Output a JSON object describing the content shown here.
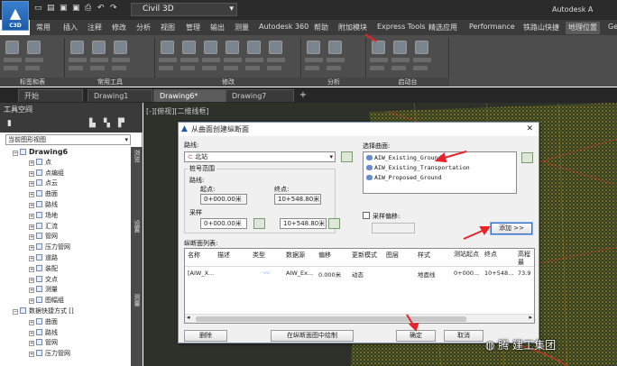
{
  "app": {
    "title": "Autodesk A",
    "app_button_label": "C3D",
    "workspace": "Civil 3D"
  },
  "ribbon": {
    "tabs": [
      "常用",
      "插入",
      "注释",
      "修改",
      "分析",
      "视图",
      "管理",
      "输出",
      "测量",
      "Autodesk 360",
      "帮助",
      "附加模块",
      "Express Tools",
      "精选应用",
      "Performance",
      "铁路山快捷",
      "地理位置",
      "Ge"
    ],
    "active_tab": "地理位置",
    "panels": [
      "标签和表",
      "常用工具",
      "修改",
      "分析",
      "启动台"
    ]
  },
  "doc_tabs": [
    "开始",
    "Drawing1",
    "Drawing6*",
    "Drawing7"
  ],
  "active_doc": "Drawing6*",
  "toolspace": {
    "title": "工具空间",
    "view_combo": "当前图形视图",
    "tree": [
      {
        "label": "Drawing6",
        "level": 0,
        "bold": true
      },
      {
        "label": "点",
        "level": 1
      },
      {
        "label": "点编组",
        "level": 1
      },
      {
        "label": "点云",
        "level": 1
      },
      {
        "label": "曲面",
        "level": 1
      },
      {
        "label": "路线",
        "level": 1
      },
      {
        "label": "场地",
        "level": 1
      },
      {
        "label": "汇流",
        "level": 1
      },
      {
        "label": "管网",
        "level": 1
      },
      {
        "label": "压力管网",
        "level": 1
      },
      {
        "label": "道路",
        "level": 1
      },
      {
        "label": "装配",
        "level": 1
      },
      {
        "label": "交点",
        "level": 1
      },
      {
        "label": "测量",
        "level": 1
      },
      {
        "label": "图幅组",
        "level": 1
      },
      {
        "label": "数据快捷方式 []",
        "level": 0
      },
      {
        "label": "曲面",
        "level": 1
      },
      {
        "label": "路线",
        "level": 1
      },
      {
        "label": "管网",
        "level": 1
      },
      {
        "label": "压力管网",
        "level": 1
      }
    ],
    "vertical_tabs": [
      "浏览",
      "设置",
      "测量"
    ]
  },
  "viewport_label": "[-][俯视][二维线框]",
  "dialog": {
    "title": "从曲面创建纵断面",
    "alignment_label": "路线:",
    "alignment_value": "北站",
    "station_range_label": "桩号范围",
    "alignment_sub_label": "路线:",
    "start_label": "起点:",
    "end_label": "终点:",
    "start_value": "0+000.00米",
    "end_value": "10+548.80米",
    "sample_label": "采样",
    "sample_start": "0+000.00米",
    "sample_end": "10+548.80米",
    "surface_label": "选择曲面:",
    "surfaces": [
      "AIW_Existing_Ground",
      "AIW_Existing_Transportation",
      "AIW_Proposed_Ground"
    ],
    "sample_offset_label": "采样偏移:",
    "add_button": "添加 >>",
    "list_label": "纵断面列表:",
    "columns": [
      "名称",
      "描述",
      "类型",
      "数据源",
      "偏移",
      "更新模式",
      "图层",
      "样式",
      "测站起点",
      "终点",
      "高程最"
    ],
    "rows": [
      {
        "name": "[AIW_X...",
        "desc": "",
        "type": "",
        "source": "AIW_Ex...",
        "offset": "0.000米",
        "mode": "动态",
        "layer": "",
        "style": "地面线",
        "start": "0+000...",
        "end": "10+548...",
        "elev": "73.9"
      }
    ],
    "remove_button": "删除",
    "draw_button": "在纵断面图中绘制",
    "ok_button": "确定",
    "cancel_button": "取消"
  },
  "watermark": "腾 建工集团",
  "colors": {
    "accent_red": "#e8232a",
    "ribbon_dark": "#4d4d4d",
    "titlebar": "#2b2b2b"
  }
}
